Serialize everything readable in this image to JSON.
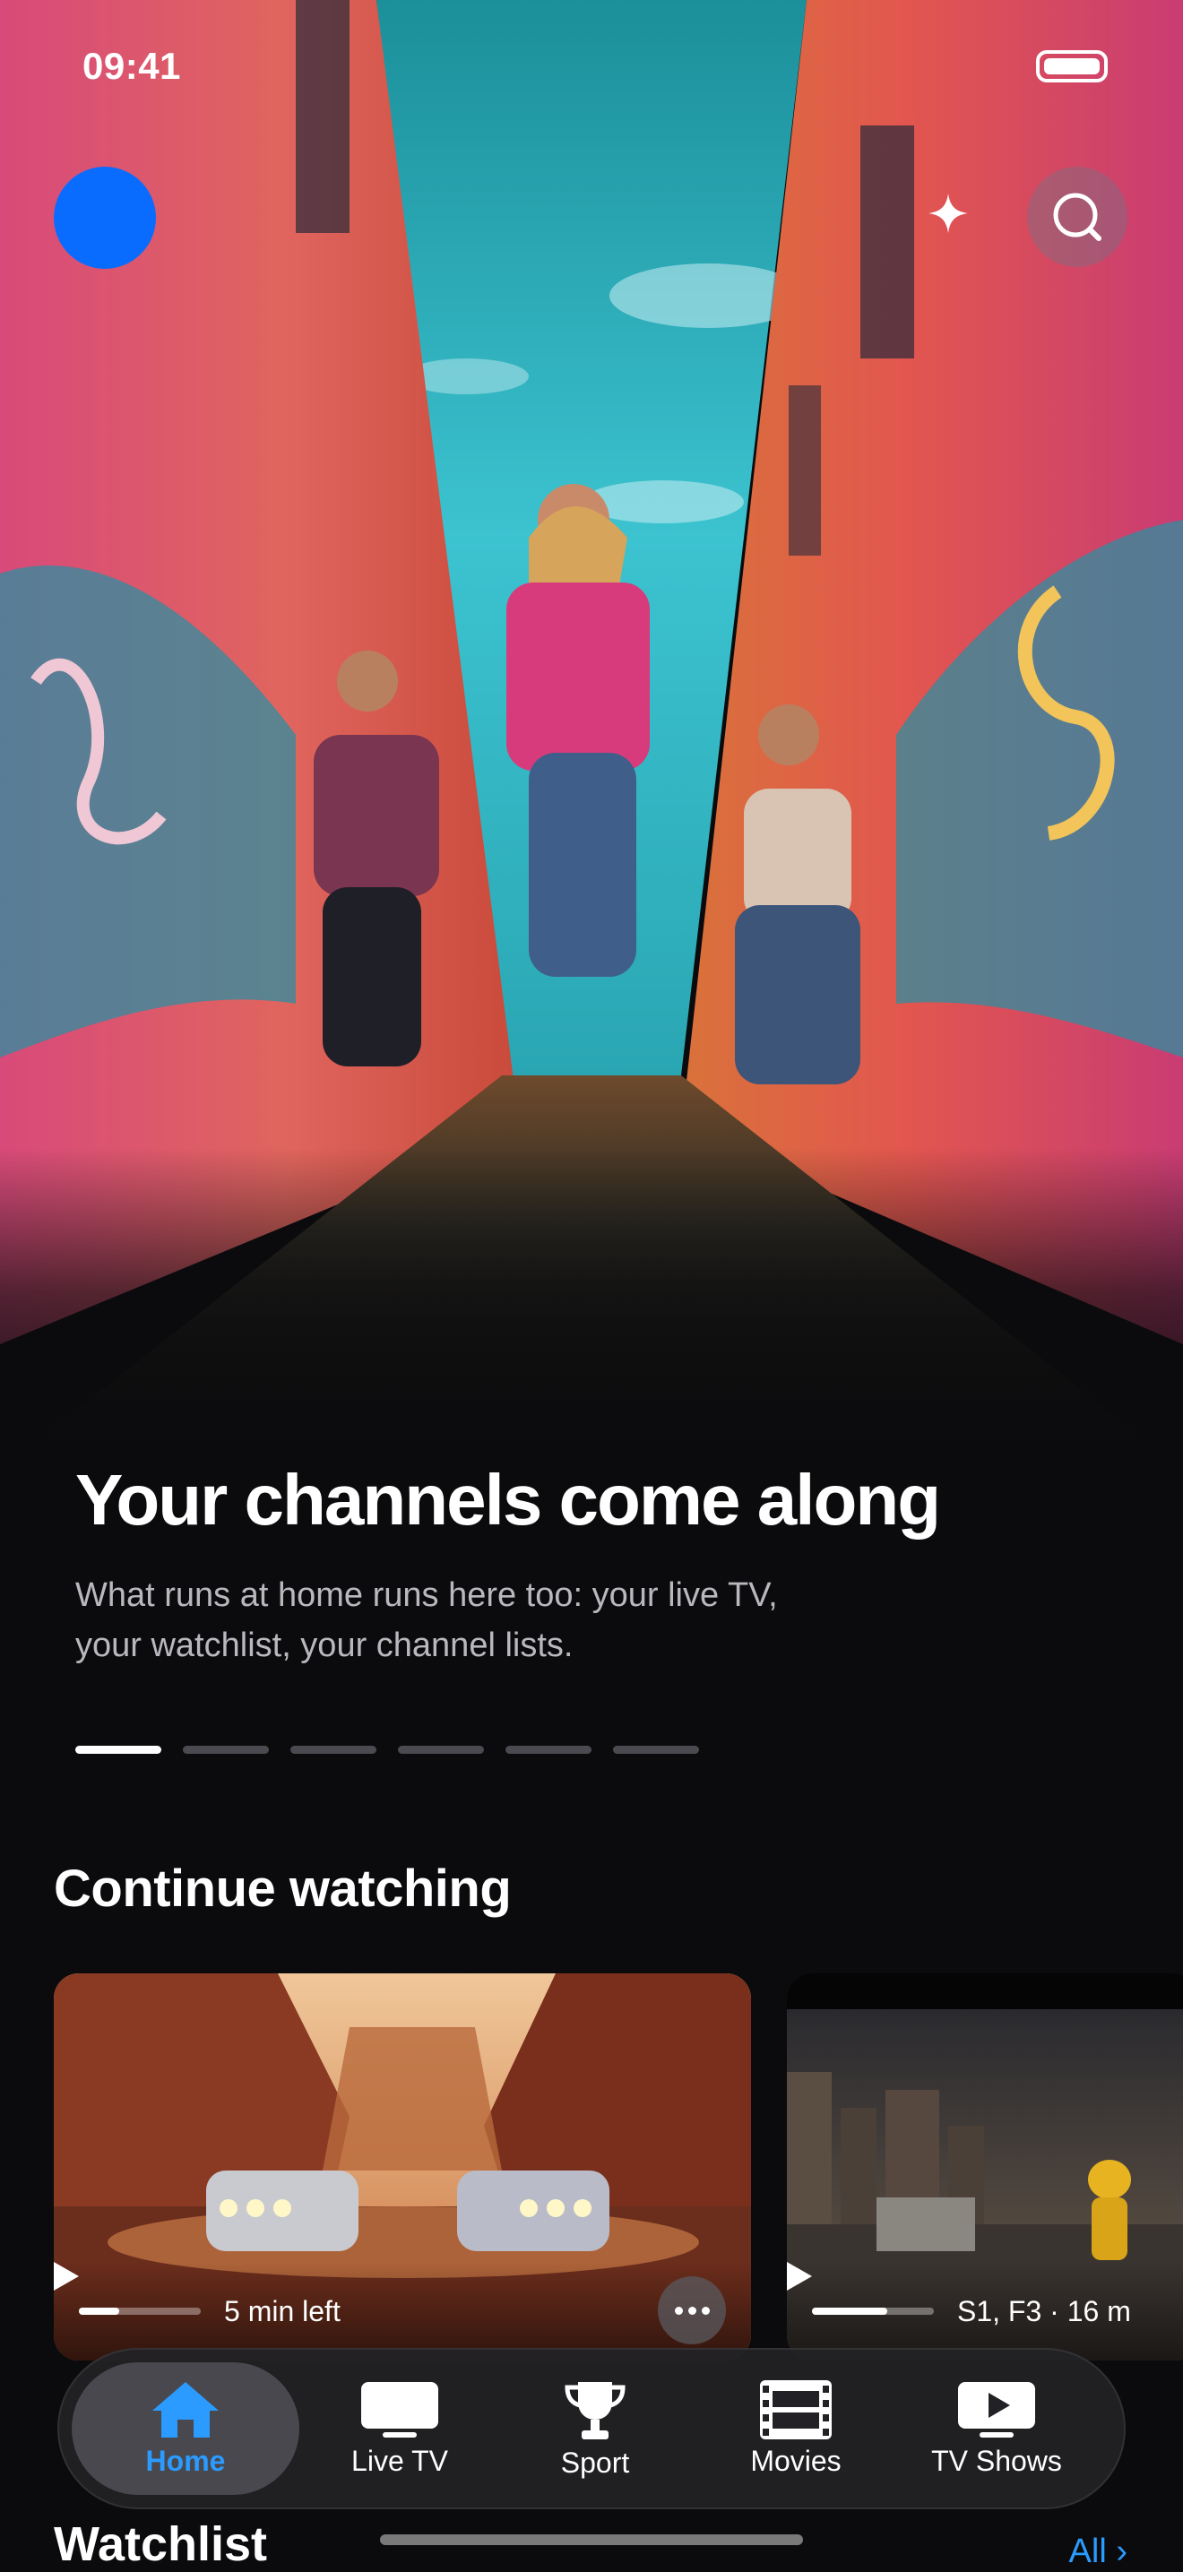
{
  "status_bar": {
    "time": "09:41"
  },
  "hero": {
    "title": "Your channels come along",
    "subtitle": "What runs at home runs here too: your live TV, your watchlist, your channel lists.",
    "pager": {
      "count": 6,
      "active_index": 0
    }
  },
  "continue_watching": {
    "title": "Continue watching",
    "items": [
      {
        "meta": "5 min left",
        "progress": 0.33
      },
      {
        "meta": "S1, F3 · 16 m",
        "progress": 0.62
      }
    ]
  },
  "tab_bar": {
    "active": "Home",
    "tabs": [
      {
        "label": "Home",
        "icon": "home-icon"
      },
      {
        "label": "Live TV",
        "icon": "tv-icon"
      },
      {
        "label": "Sport",
        "icon": "trophy-icon"
      },
      {
        "label": "Movies",
        "icon": "film-icon"
      },
      {
        "label": "TV Shows",
        "icon": "play-screen-icon"
      }
    ]
  },
  "watchlist": {
    "title": "Watchlist",
    "all_label": "All"
  },
  "colors": {
    "accent": "#2b9bff",
    "avatar": "#0a6cff",
    "background": "#0b0b0d"
  }
}
